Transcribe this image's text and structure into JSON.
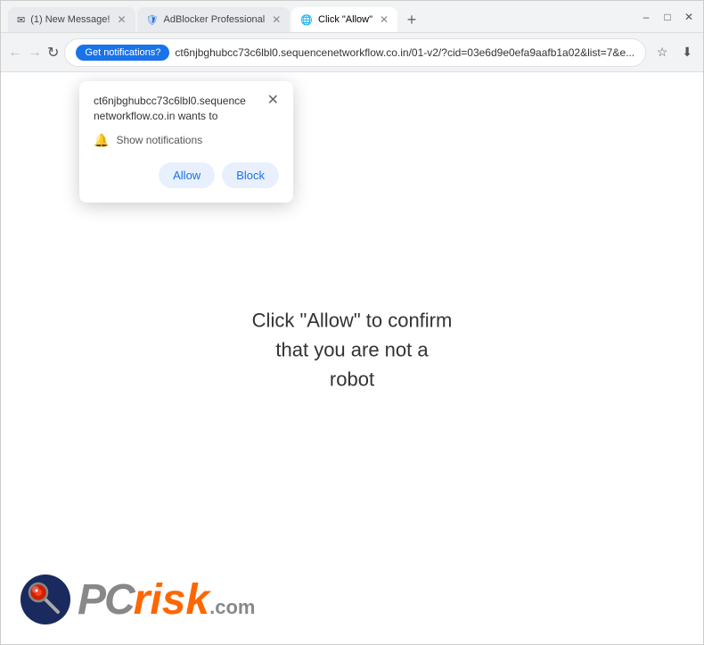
{
  "browser": {
    "tabs": [
      {
        "id": "tab-new-message",
        "label": "(1) New Message!",
        "active": false,
        "favicon": "envelope"
      },
      {
        "id": "tab-adblocker",
        "label": "AdBlocker Professional",
        "active": false,
        "favicon": "shield"
      },
      {
        "id": "tab-click-allow",
        "label": "Click \"Allow\"",
        "active": true,
        "favicon": "globe"
      }
    ],
    "new_tab_label": "+",
    "window_controls": {
      "minimize": "–",
      "maximize": "□",
      "close": "✕"
    }
  },
  "address_bar": {
    "notification_chip": "Get notifications?",
    "url": "ct6njbghubcc73c6lbl0.sequencenetworkflow.co.in/01-v2/?cid=03e6d9e0efa9aafb1a02&list=7&e...",
    "icons": {
      "bookmark": "☆",
      "download": "⬇",
      "profile": "👤",
      "menu": "⋮"
    }
  },
  "notification_popup": {
    "site_line1": "ct6njbghubcc73c6lbl0.sequence",
    "site_line2": "networkflow.co.in wants to",
    "close_symbol": "✕",
    "permission_text": "Show notifications",
    "allow_label": "Allow",
    "block_label": "Block"
  },
  "page": {
    "main_text_line1": "Click \"Allow\" to confirm",
    "main_text_line2": "that you are not a",
    "main_text_line3": "robot"
  },
  "logo": {
    "pc_text": "PC",
    "risk_text": "risk",
    "com_text": ".com"
  },
  "colors": {
    "accent": "#1a73e8",
    "orange": "#ff6600",
    "gray": "#666666"
  }
}
